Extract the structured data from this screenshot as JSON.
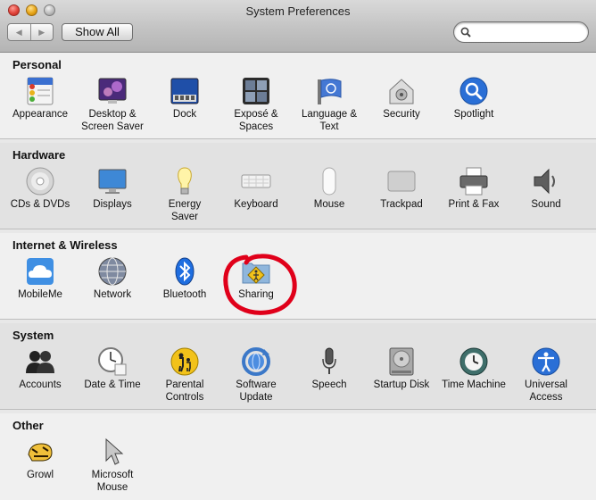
{
  "window": {
    "title": "System Preferences"
  },
  "toolbar": {
    "back": "◀",
    "forward": "▶",
    "show_all": "Show All"
  },
  "search": {
    "value": "",
    "placeholder": ""
  },
  "sections": {
    "personal": {
      "title": "Personal",
      "items": [
        "Appearance",
        "Desktop &\nScreen Saver",
        "Dock",
        "Exposé &\nSpaces",
        "Language &\nText",
        "Security",
        "Spotlight"
      ]
    },
    "hardware": {
      "title": "Hardware",
      "items": [
        "CDs & DVDs",
        "Displays",
        "Energy\nSaver",
        "Keyboard",
        "Mouse",
        "Trackpad",
        "Print & Fax",
        "Sound"
      ]
    },
    "internet": {
      "title": "Internet & Wireless",
      "items": [
        "MobileMe",
        "Network",
        "Bluetooth",
        "Sharing"
      ]
    },
    "system": {
      "title": "System",
      "items": [
        "Accounts",
        "Date & Time",
        "Parental\nControls",
        "Software\nUpdate",
        "Speech",
        "Startup Disk",
        "Time Machine",
        "Universal\nAccess"
      ]
    },
    "other": {
      "title": "Other",
      "items": [
        "Growl",
        "Microsoft\nMouse"
      ]
    }
  },
  "colors": {
    "annotation": "#e0001a",
    "accent_blue": "#2a6fd6"
  }
}
